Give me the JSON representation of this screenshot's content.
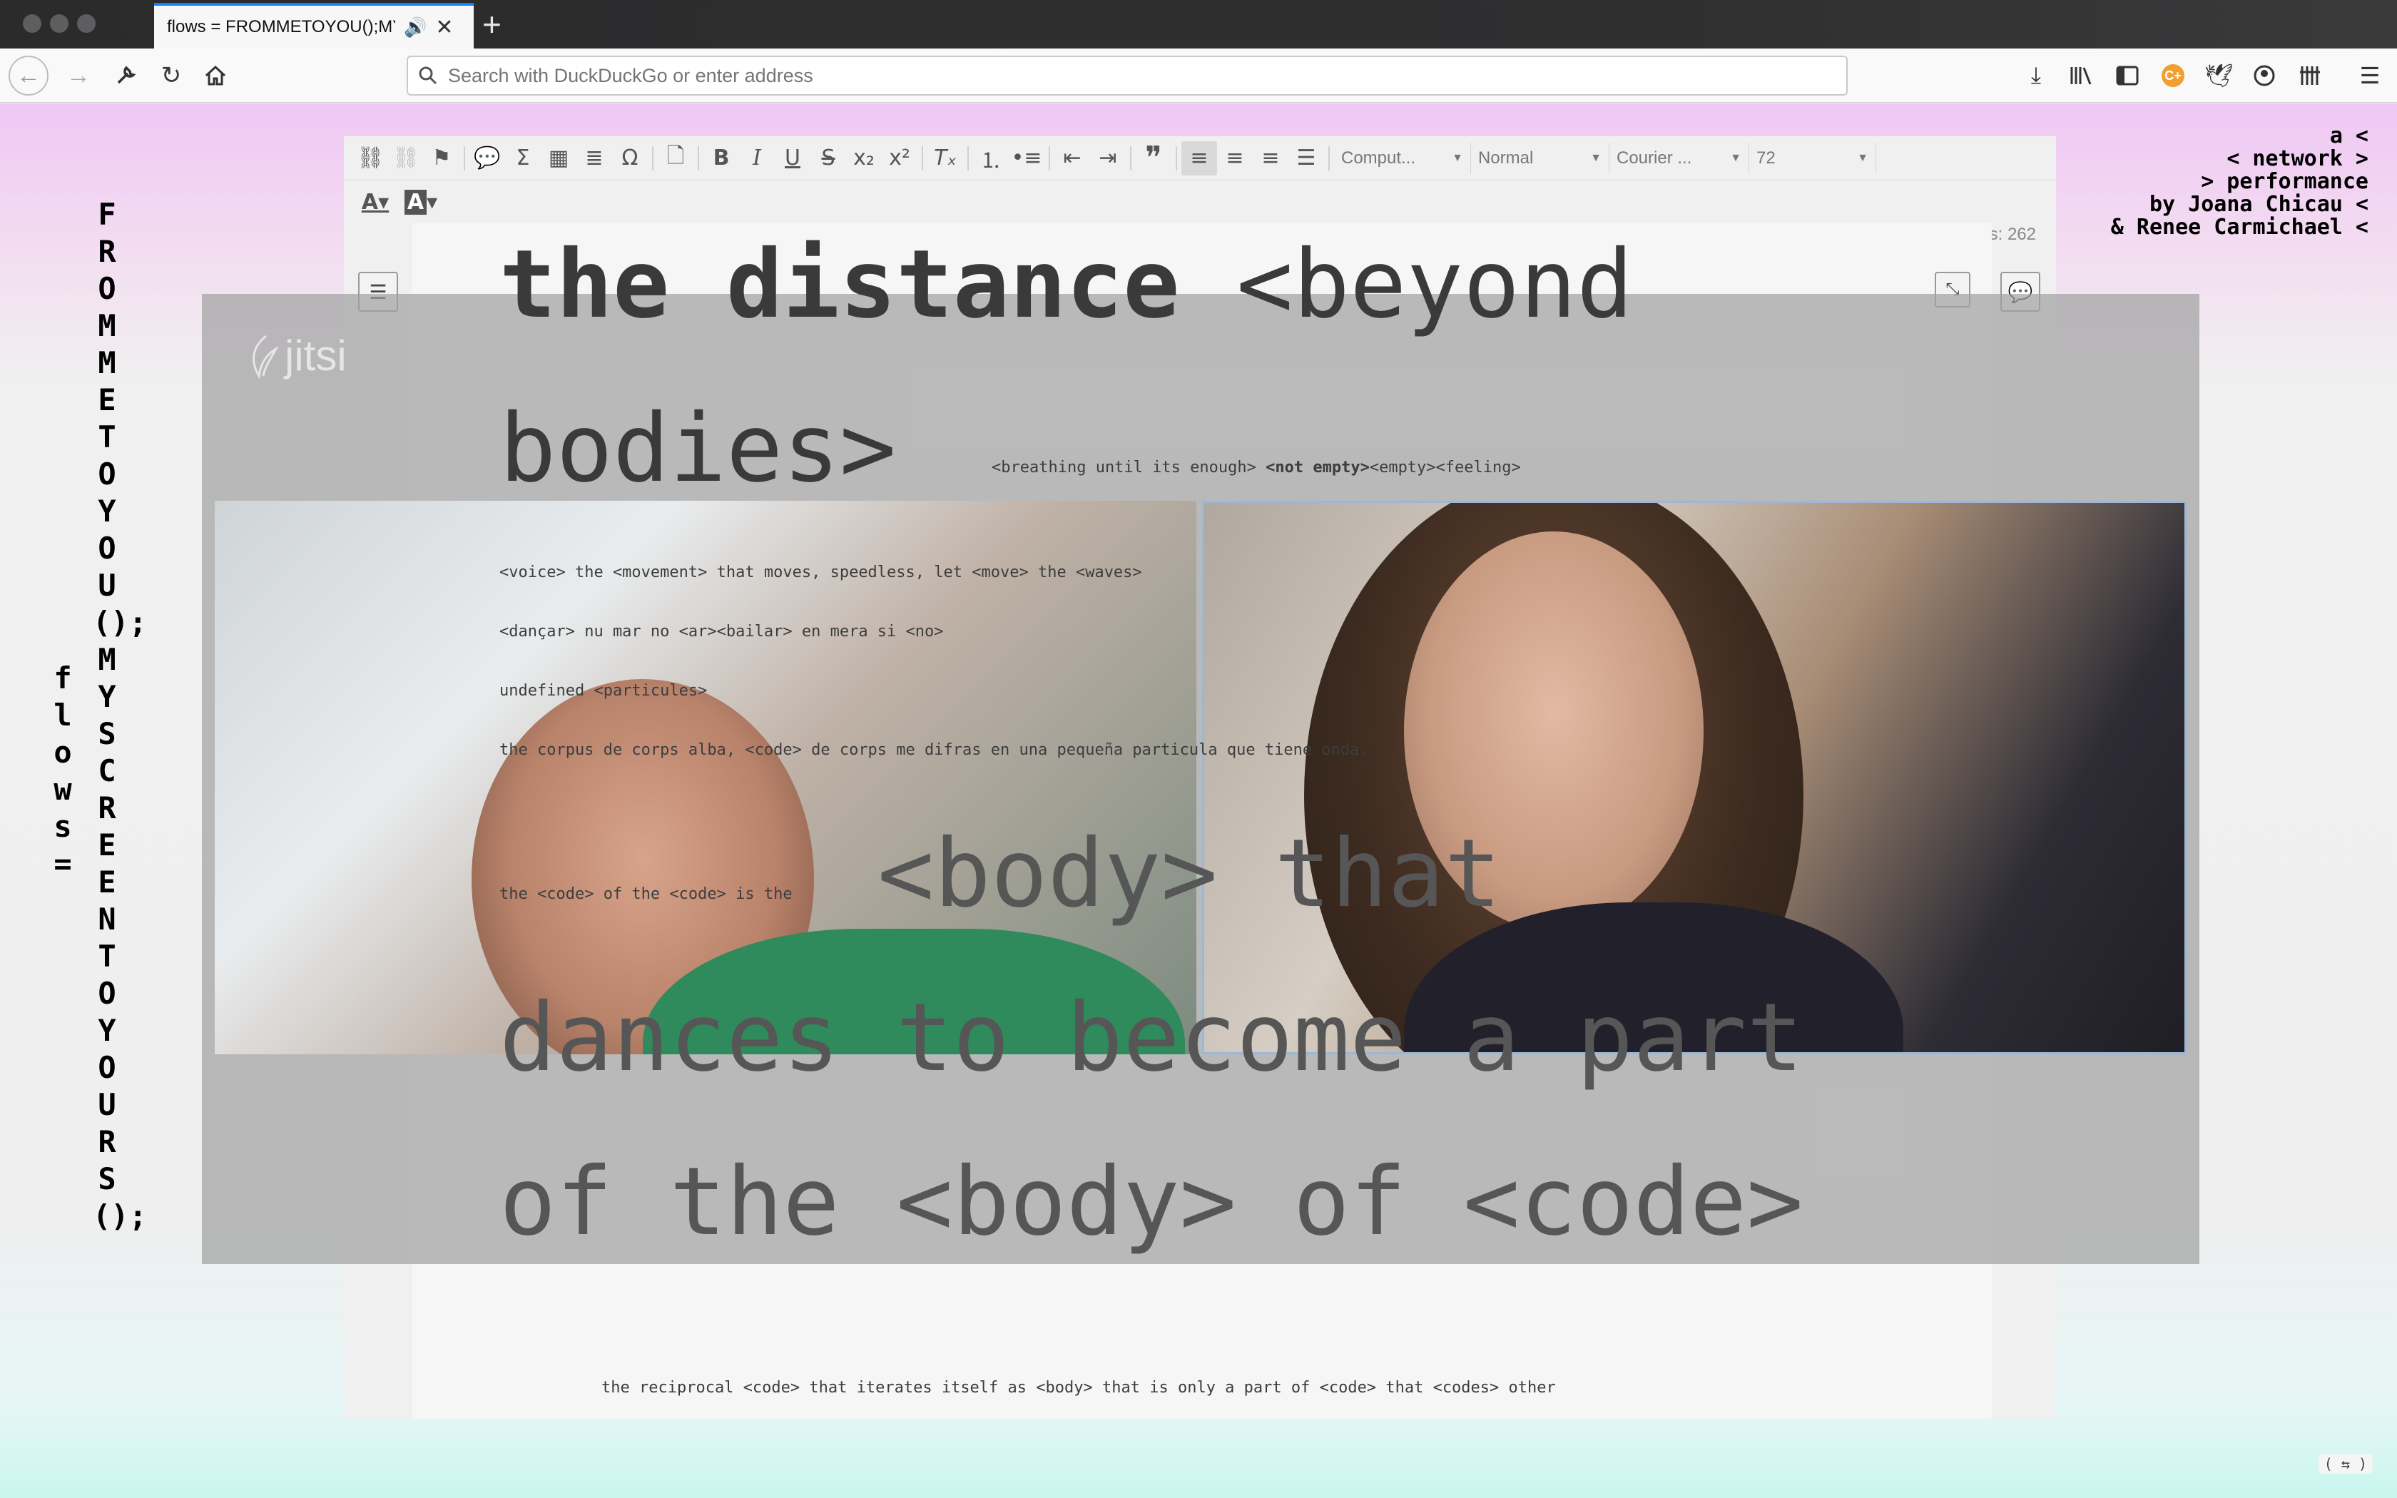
{
  "browser": {
    "tab_title": "flows = FROMMETOYOU();MYSCREENTOYOURS();",
    "search_placeholder": "Search with DuckDuckGo or enter address"
  },
  "page": {
    "vertical_right": "FROMMETOYOU();MYSCREENTOYOURS();",
    "vertical_left": "flows =",
    "credits": "a <\n< network >\n> performance\nby Joana Chicau <\n& Renee Carmichael <"
  },
  "editor": {
    "combo_format": "Comput...",
    "combo_style": "Normal",
    "combo_font": "Courier ...",
    "combo_size": "72",
    "words": "Words: 262"
  },
  "jitsi": {
    "logo": "jitsi"
  },
  "document": {
    "heading1_bold": "the distance",
    "heading1_rest": "<beyond",
    "heading2": "bodies>",
    "breathing_a": "<breathing until its enough>",
    "breathing_b": "<not empty>",
    "breathing_c": "<empty><feeling>",
    "line_voice": "<voice> the <movement> that moves, speedless, let <move> the <waves>",
    "line_dancar": "<dançar> nu mar no <ar><bailar> en mera si <no>",
    "line_undefined": "undefined <particules>",
    "line_corpus": "the corpus de corps alba, <code> de corps me difras en una pequeña particula que tiene onda.",
    "line_code": "the <code> of the <code> is the",
    "big_body_that": "<body> that",
    "big_dances": "dances to become a part",
    "big_of": "of the <body> of <code>",
    "line_reciprocal": "the reciprocal <code> that iterates itself as <body> that is only a part of <code> that <codes> other"
  },
  "status_pill": "( ⇆ )"
}
